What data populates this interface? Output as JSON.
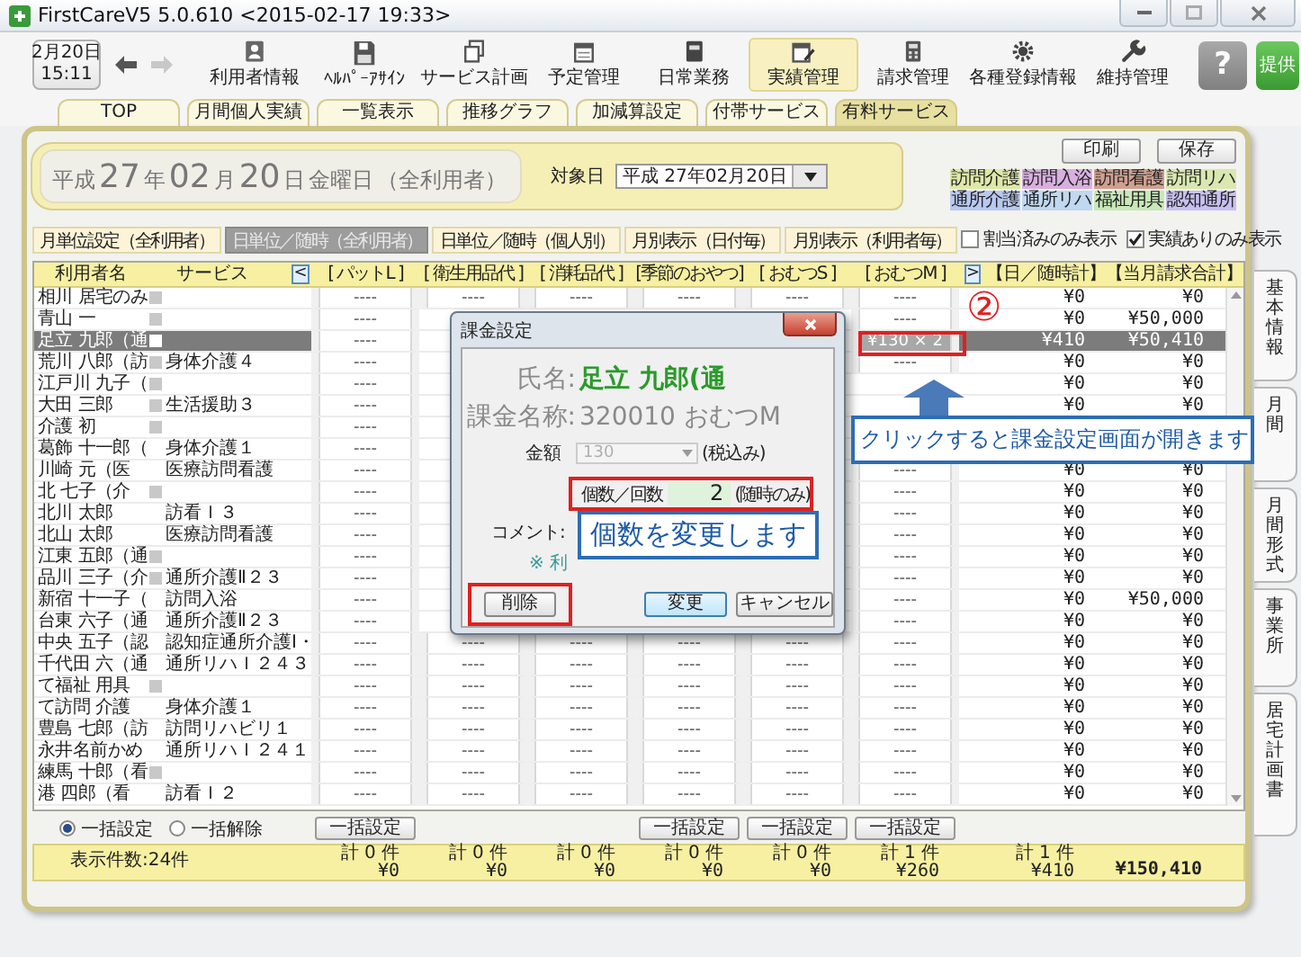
{
  "window": {
    "title": "FirstCareV5 5.0.610 <2015-02-17 19:33>"
  },
  "toolbar": {
    "date": "2月20日",
    "time": "15:11",
    "nav": [
      {
        "disabled": false
      },
      {
        "disabled": true
      }
    ],
    "tools": [
      {
        "label": "利用者情報",
        "selected": false
      },
      {
        "label": "ﾍﾙﾊﾟｰｱｻｲﾝ",
        "selected": false
      },
      {
        "label": "サービス計画",
        "selected": false
      },
      {
        "label": "予定管理",
        "selected": false
      },
      {
        "label": "日常業務",
        "selected": false
      },
      {
        "label": "実績管理",
        "selected": true
      },
      {
        "label": "請求管理",
        "selected": false
      },
      {
        "label": "各種登録情報",
        "selected": false
      },
      {
        "label": "維持管理",
        "selected": false
      }
    ],
    "help": "?",
    "provide": "提供"
  },
  "tabs": [
    {
      "label": "TOP",
      "selected": false
    },
    {
      "label": "月間個人実績",
      "selected": false
    },
    {
      "label": "一覧表示",
      "selected": false
    },
    {
      "label": "推移グラフ",
      "selected": false
    },
    {
      "label": "加減算設定",
      "selected": false
    },
    {
      "label": "付帯サービス",
      "selected": false
    },
    {
      "label": "有料サービス",
      "selected": true
    }
  ],
  "header": {
    "date_parts": [
      {
        "text": "平成",
        "kind": "unit"
      },
      {
        "text": "27",
        "kind": "num"
      },
      {
        "text": "年",
        "kind": "unit"
      },
      {
        "text": "02",
        "kind": "num"
      },
      {
        "text": "月",
        "kind": "unit"
      },
      {
        "text": "20",
        "kind": "num"
      },
      {
        "text": "日",
        "kind": "unit"
      },
      {
        "text": "金曜日",
        "kind": "unit"
      },
      {
        "text": "（全利用者）",
        "kind": "unit"
      }
    ],
    "target_label": "対象日",
    "target_value": "平成 27年02月20日",
    "actions": [
      "印刷",
      "保存"
    ],
    "categories": [
      {
        "label": "訪問介護",
        "color": "#dfe8a8"
      },
      {
        "label": "訪問入浴",
        "color": "#d8b0e0"
      },
      {
        "label": "訪問看護",
        "color": "#d0a090"
      },
      {
        "label": "訪問リハ",
        "color": "#d8e8b0"
      },
      {
        "label": "通所介護",
        "color": "#b8c8f0"
      },
      {
        "label": "通所リハ",
        "color": "#c0d8f0"
      },
      {
        "label": "福祉用具",
        "color": "#c8e8b8"
      },
      {
        "label": "認知通所",
        "color": "#c8c0f0"
      }
    ],
    "modes": [
      {
        "label": "月単位設定（全利用者）",
        "selected": false
      },
      {
        "label": "日単位／随時（全利用者）",
        "selected": true
      },
      {
        "label": "日単位／随時（個人別）",
        "selected": false
      },
      {
        "label": "月別表示（日付毎）",
        "selected": false
      },
      {
        "label": "月別表示（利用者毎）",
        "selected": false
      }
    ],
    "filters": [
      {
        "label": "割当済みのみ表示",
        "checked": false
      },
      {
        "label": "実績ありのみ表示",
        "checked": true
      }
    ]
  },
  "table": {
    "columns": {
      "name": "利用者名",
      "service": "サービス",
      "prev": "<",
      "items": [
        "[ パットL ]",
        "[ 衛生用品代 ]",
        "[ 消耗品代 ]",
        "[季節のおやつ]",
        "[ おむつS ]",
        "[ おむつM ]"
      ],
      "next": ">",
      "totals": "【日／随時計】【当月請求合計】"
    },
    "rows": [
      {
        "name": "相川 居宅のみ",
        "flag": true,
        "selected": false,
        "cells": [
          {
            "text": "----",
            "selected": false
          },
          {
            "text": "----",
            "selected": false
          },
          {
            "text": "----",
            "selected": false
          },
          {
            "text": "----",
            "selected": false
          },
          {
            "text": "----",
            "selected": false
          },
          {
            "text": "----",
            "selected": false
          }
        ],
        "day_total": "¥0",
        "month_total": "¥0"
      },
      {
        "name": "青山 一",
        "flag": true,
        "selected": false,
        "cells": [
          {
            "text": "----",
            "selected": false
          },
          null,
          null,
          null,
          null,
          {
            "text": "----",
            "selected": false
          }
        ],
        "day_total": "¥0",
        "month_total": "¥50,000"
      },
      {
        "name": "足立 九郎（通",
        "flag": true,
        "selected": true,
        "cells": [
          {
            "text": "----",
            "selected": false
          },
          null,
          null,
          null,
          null,
          {
            "text": "¥130 × 2",
            "selected": true
          }
        ],
        "day_total": "¥410",
        "month_total": "¥50,410"
      },
      {
        "name": "荒川 八郎（訪",
        "flag": true,
        "service": "身体介護４",
        "selected": false,
        "cells": [
          {
            "text": "----",
            "selected": false
          },
          null,
          null,
          null,
          null,
          {
            "text": "----",
            "selected": false
          }
        ],
        "day_total": "¥0",
        "month_total": "¥0"
      },
      {
        "name": "江戸川 九子（",
        "flag": true,
        "selected": false,
        "cells": [
          {
            "text": "----",
            "selected": false
          },
          null,
          null,
          null,
          null,
          null
        ],
        "day_total": "¥0",
        "month_total": "¥0"
      },
      {
        "name": "大田 三郎",
        "flag": true,
        "service": "生活援助３",
        "selected": false,
        "cells": [
          {
            "text": "----",
            "selected": false
          },
          null,
          null,
          null,
          null,
          null
        ],
        "day_total": "¥0",
        "month_total": "¥0"
      },
      {
        "name": "介護 初",
        "flag": true,
        "selected": false,
        "cells": [
          {
            "text": "----",
            "selected": false
          },
          null,
          null,
          null,
          null,
          null
        ],
        "day_total": null,
        "month_total": null
      },
      {
        "name": "葛飾 十一郎（",
        "flag": false,
        "service": "身体介護１",
        "selected": false,
        "cells": [
          {
            "text": "----",
            "selected": false
          },
          null,
          null,
          null,
          null,
          null
        ],
        "day_total": null,
        "month_total": null
      },
      {
        "name": "川崎 元（医",
        "flag": false,
        "service": "医療訪問看護",
        "selected": false,
        "cells": [
          {
            "text": "----",
            "selected": false
          },
          null,
          null,
          null,
          null,
          {
            "text": "----",
            "selected": false
          }
        ],
        "day_total": "¥0",
        "month_total": "¥0"
      },
      {
        "name": "北 七子（介",
        "flag": true,
        "selected": false,
        "cells": [
          {
            "text": "----",
            "selected": false
          },
          null,
          null,
          null,
          null,
          {
            "text": "----",
            "selected": false
          }
        ],
        "day_total": "¥0",
        "month_total": "¥0"
      },
      {
        "name": "北川 太郎",
        "flag": false,
        "service": "訪看Ｉ３",
        "selected": false,
        "cells": [
          {
            "text": "----",
            "selected": false
          },
          null,
          null,
          null,
          null,
          {
            "text": "----",
            "selected": false
          }
        ],
        "day_total": "¥0",
        "month_total": "¥0"
      },
      {
        "name": "北山 太郎",
        "flag": false,
        "service": "医療訪問看護",
        "selected": false,
        "cells": [
          {
            "text": "----",
            "selected": false
          },
          null,
          null,
          null,
          null,
          {
            "text": "----",
            "selected": false
          }
        ],
        "day_total": "¥0",
        "month_total": "¥0"
      },
      {
        "name": "江東 五郎（通",
        "flag": true,
        "selected": false,
        "cells": [
          {
            "text": "----",
            "selected": false
          },
          null,
          null,
          null,
          null,
          {
            "text": "----",
            "selected": false
          }
        ],
        "day_total": "¥0",
        "month_total": "¥0"
      },
      {
        "name": "品川 三子（介",
        "flag": true,
        "service": "通所介護Ⅱ２３",
        "selected": false,
        "cells": [
          {
            "text": "----",
            "selected": false
          },
          null,
          null,
          null,
          null,
          {
            "text": "----",
            "selected": false
          }
        ],
        "day_total": "¥0",
        "month_total": "¥0"
      },
      {
        "name": "新宿 十一子（",
        "flag": false,
        "service": "訪問入浴",
        "selected": false,
        "cells": [
          {
            "text": "----",
            "selected": false
          },
          null,
          null,
          null,
          null,
          {
            "text": "----",
            "selected": false
          }
        ],
        "day_total": "¥0",
        "month_total": "¥50,000"
      },
      {
        "name": "台東 六子（通",
        "flag": false,
        "service": "通所介護Ⅱ２３",
        "selected": false,
        "cells": [
          {
            "text": "----",
            "selected": false
          },
          null,
          null,
          null,
          null,
          {
            "text": "----",
            "selected": false
          }
        ],
        "day_total": "¥0",
        "month_total": "¥0"
      },
      {
        "name": "中央 五子（認",
        "flag": false,
        "service": "認知症通所介護Ⅰ・",
        "selected": false,
        "cells": [
          {
            "text": "----",
            "selected": false
          },
          {
            "text": "----",
            "selected": false
          },
          {
            "text": "----",
            "selected": false
          },
          {
            "text": "----",
            "selected": false
          },
          {
            "text": "----",
            "selected": false
          },
          {
            "text": "----",
            "selected": false
          }
        ],
        "day_total": "¥0",
        "month_total": "¥0"
      },
      {
        "name": "千代田 六（通",
        "flag": false,
        "service": "通所リハＩ２４３",
        "selected": false,
        "cells": [
          {
            "text": "----",
            "selected": false
          },
          {
            "text": "----",
            "selected": false
          },
          {
            "text": "----",
            "selected": false
          },
          {
            "text": "----",
            "selected": false
          },
          {
            "text": "----",
            "selected": false
          },
          {
            "text": "----",
            "selected": false
          }
        ],
        "day_total": "¥0",
        "month_total": "¥0"
      },
      {
        "name": "て福祉 用具",
        "flag": true,
        "selected": false,
        "cells": [
          {
            "text": "----",
            "selected": false
          },
          {
            "text": "----",
            "selected": false
          },
          {
            "text": "----",
            "selected": false
          },
          {
            "text": "----",
            "selected": false
          },
          {
            "text": "----",
            "selected": false
          },
          {
            "text": "----",
            "selected": false
          }
        ],
        "day_total": "¥0",
        "month_total": "¥0"
      },
      {
        "name": "て訪問 介護",
        "flag": false,
        "service": "身体介護１",
        "selected": false,
        "cells": [
          {
            "text": "----",
            "selected": false
          },
          {
            "text": "----",
            "selected": false
          },
          {
            "text": "----",
            "selected": false
          },
          {
            "text": "----",
            "selected": false
          },
          {
            "text": "----",
            "selected": false
          },
          {
            "text": "----",
            "selected": false
          }
        ],
        "day_total": "¥0",
        "month_total": "¥0"
      },
      {
        "name": "豊島 七郎（訪",
        "flag": false,
        "service": "訪問リハビリ１",
        "selected": false,
        "cells": [
          {
            "text": "----",
            "selected": false
          },
          {
            "text": "----",
            "selected": false
          },
          {
            "text": "----",
            "selected": false
          },
          {
            "text": "----",
            "selected": false
          },
          {
            "text": "----",
            "selected": false
          },
          {
            "text": "----",
            "selected": false
          }
        ],
        "day_total": "¥0",
        "month_total": "¥0"
      },
      {
        "name": "永井名前かめ",
        "flag": false,
        "service": "通所リハＩ２４１",
        "selected": false,
        "cells": [
          {
            "text": "----",
            "selected": false
          },
          {
            "text": "----",
            "selected": false
          },
          {
            "text": "----",
            "selected": false
          },
          {
            "text": "----",
            "selected": false
          },
          {
            "text": "----",
            "selected": false
          },
          {
            "text": "----",
            "selected": false
          }
        ],
        "day_total": "¥0",
        "month_total": "¥0"
      },
      {
        "name": "練馬 十郎（看",
        "flag": true,
        "selected": false,
        "cells": [
          {
            "text": "----",
            "selected": false
          },
          {
            "text": "----",
            "selected": false
          },
          {
            "text": "----",
            "selected": false
          },
          {
            "text": "----",
            "selected": false
          },
          {
            "text": "----",
            "selected": false
          },
          {
            "text": "----",
            "selected": false
          }
        ],
        "day_total": "¥0",
        "month_total": "¥0"
      },
      {
        "name": "港 四郎（看",
        "flag": false,
        "service": "訪看Ｉ２",
        "selected": false,
        "cells": [
          {
            "text": "----",
            "selected": false
          },
          {
            "text": "----",
            "selected": false
          },
          {
            "text": "----",
            "selected": false
          },
          {
            "text": "----",
            "selected": false
          },
          {
            "text": "----",
            "selected": false
          },
          {
            "text": "----",
            "selected": false
          }
        ],
        "day_total": "¥0",
        "month_total": "¥0"
      }
    ]
  },
  "bulk": {
    "options": [
      {
        "label": "一括設定",
        "selected": true
      },
      {
        "label": "一括解除",
        "selected": false
      }
    ],
    "buttons": [
      "一括設定",
      "一括設定",
      "一括設定",
      "一括設定"
    ]
  },
  "summary": {
    "count": "表示件数:24件",
    "columns": [
      {
        "count": "計 0 件",
        "amount": "¥0"
      },
      {
        "count": "計 0 件",
        "amount": "¥0"
      },
      {
        "count": "計 0 件",
        "amount": "¥0"
      },
      {
        "count": "計 0 件",
        "amount": "¥0"
      },
      {
        "count": "計 0 件",
        "amount": "¥0"
      },
      {
        "count": "計 1 件",
        "amount": "¥260"
      }
    ],
    "day_total": {
      "count": "計 1 件",
      "amount": "¥410"
    },
    "month_total": "¥150,410"
  },
  "side_tabs": [
    "基本情報",
    "月間",
    "月間形式",
    "事業所",
    "居宅計画書"
  ],
  "dialog": {
    "title": "課金設定",
    "name_label": "氏名:",
    "name": "足立 九郎(通",
    "item_label": "課金名称:",
    "item": "320010 おむつM",
    "amount_label": "金額",
    "amount": {
      "value": "130",
      "disabled": true
    },
    "amount_note": "(税込み)",
    "quantity_label": "個数／回数",
    "quantity": "2",
    "quantity_note": "(随時のみ)",
    "comment_label": "コメント:",
    "note": "※ 利",
    "buttons": [
      {
        "label": "削除",
        "default": false
      },
      {
        "label": "変更",
        "default": true
      },
      {
        "label": "キャンセル",
        "default": false
      }
    ]
  },
  "annotations": {
    "step": "②",
    "callouts": [
      "クリックすると課金設定画面が開きます",
      "個数を変更します"
    ]
  }
}
